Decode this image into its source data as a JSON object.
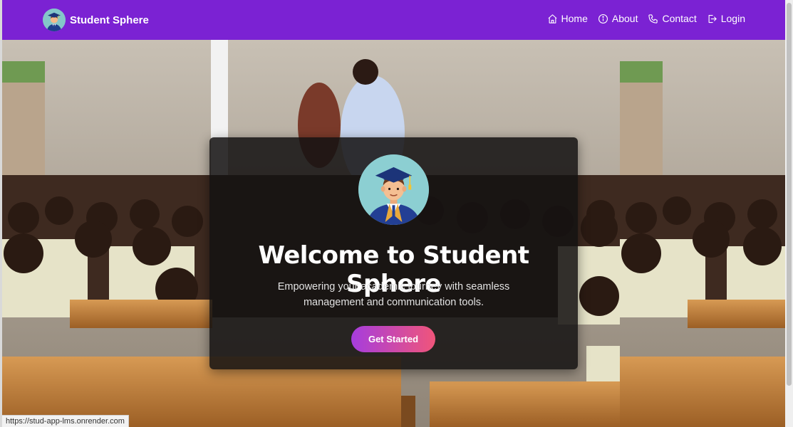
{
  "brand": {
    "name": "Student Sphere",
    "logo_icon": "graduate-avatar-icon"
  },
  "nav": {
    "items": [
      {
        "label": "Home",
        "icon": "home-icon"
      },
      {
        "label": "About",
        "icon": "info-icon"
      },
      {
        "label": "Contact",
        "icon": "phone-icon"
      },
      {
        "label": "Login",
        "icon": "login-icon"
      }
    ]
  },
  "hero": {
    "background": "classroom-students-photo",
    "title": "Welcome to Student Sphere",
    "subtitle": "Empowering your academic journey with seamless management and communication tools.",
    "cta_label": "Get Started",
    "avatar_icon": "graduate-avatar-icon"
  },
  "status_bar": {
    "url": "https://stud-app-lms.onrender.com"
  },
  "colors": {
    "navbar": "#7b22d3",
    "cta_gradient_start": "#a63ddd",
    "cta_gradient_end": "#f0557a",
    "card_background": "#141212"
  }
}
